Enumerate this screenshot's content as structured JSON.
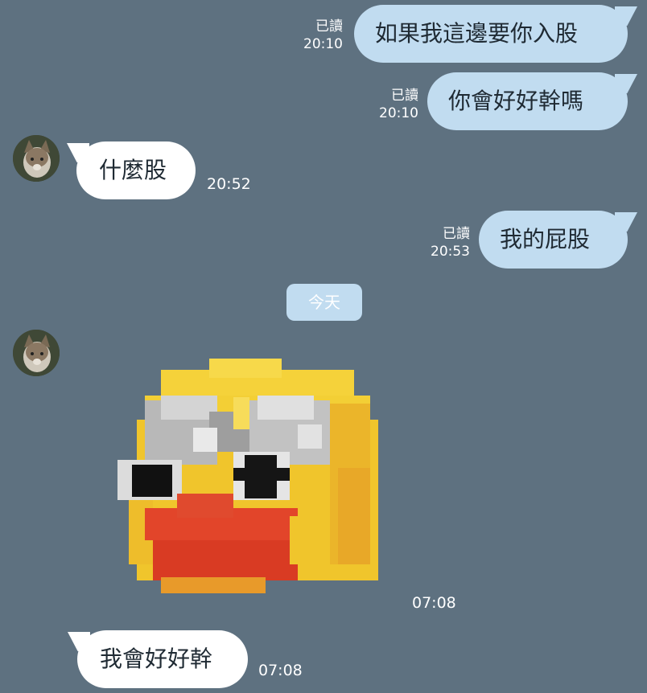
{
  "messages": [
    {
      "side": "out",
      "text": "如果我這邊要你入股",
      "read": "已讀",
      "time": "20:10"
    },
    {
      "side": "out",
      "text": "你會好好幹嗎",
      "read": "已讀",
      "time": "20:10"
    },
    {
      "side": "in",
      "text": "什麼股",
      "time": "20:52"
    },
    {
      "side": "out",
      "text": "我的屁股",
      "read": "已讀",
      "time": "20:53"
    },
    {
      "side": "in",
      "type": "sticker",
      "sticker": "pixel-duck-face-sticker",
      "time": "07:08"
    },
    {
      "side": "in",
      "text": "我會好好幹",
      "time": "07:08"
    }
  ],
  "date_separator": "今天",
  "colors": {
    "background": "#5e7180",
    "outgoing_bubble": "#c1dcf0",
    "incoming_bubble": "#ffffff"
  }
}
